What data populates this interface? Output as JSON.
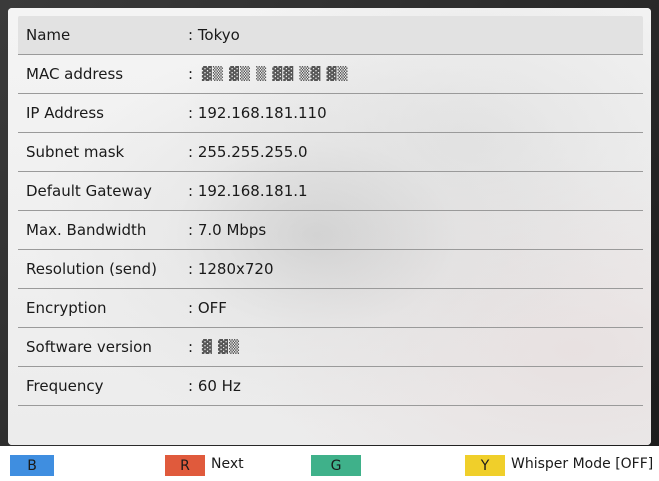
{
  "rows": [
    {
      "label": "Name",
      "value": ": Tokyo"
    },
    {
      "label": "MAC address",
      "value": ":",
      "masked": "▓▒ ▓▒ ▒ ▓▓ ▒▓ ▓▒"
    },
    {
      "label": "IP Address",
      "value": ": 192.168.181.110"
    },
    {
      "label": "Subnet mask",
      "value": ": 255.255.255.0"
    },
    {
      "label": "Default Gateway",
      "value": ": 192.168.181.1"
    },
    {
      "label": "Max. Bandwidth",
      "value": ": 7.0 Mbps"
    },
    {
      "label": "Resolution (send)",
      "value": ": 1280x720"
    },
    {
      "label": "Encryption",
      "value": ": OFF"
    },
    {
      "label": "Software version",
      "value": ":",
      "masked": "▓ ▓▒"
    },
    {
      "label": "Frequency",
      "value": ": 60 Hz"
    }
  ],
  "footer": {
    "b_key": "B",
    "r_key": "R",
    "r_label": "Next",
    "g_key": "G",
    "y_key": "Y",
    "y_label": "Whisper Mode [OFF]"
  }
}
